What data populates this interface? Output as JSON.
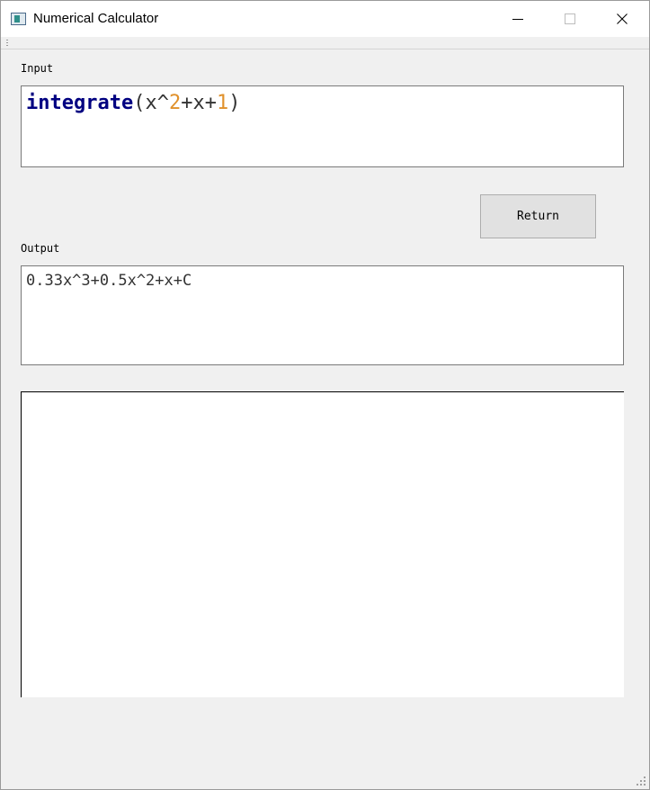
{
  "window": {
    "title": "Numerical Calculator",
    "icon": "app-window-icon",
    "controls": [
      "minimize-icon",
      "maximize-icon",
      "close-icon"
    ]
  },
  "input": {
    "label": "Input",
    "function_name": "integrate",
    "tokens": [
      {
        "text": "integrate",
        "kind": "keyword"
      },
      {
        "text": "(x^",
        "kind": "plain"
      },
      {
        "text": "2",
        "kind": "number"
      },
      {
        "text": "+x+",
        "kind": "plain"
      },
      {
        "text": "1",
        "kind": "number"
      },
      {
        "text": ")",
        "kind": "plain"
      }
    ]
  },
  "actions": {
    "return_label": "Return"
  },
  "output": {
    "label": "Output",
    "value": "0.33x^3+0.5x^2+x+C"
  },
  "colors": {
    "keyword": "#000080",
    "number": "#e0912b",
    "text": "#333333",
    "window_bg": "#f0f0f0"
  }
}
